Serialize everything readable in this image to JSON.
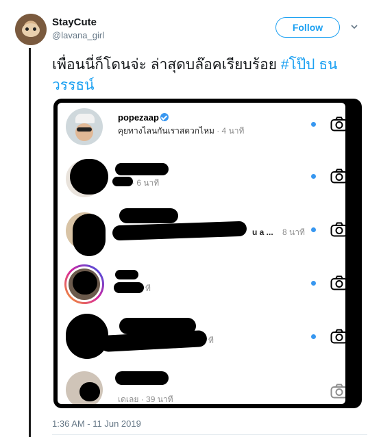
{
  "tweet": {
    "display_name": "StayCute",
    "handle": "@lavana_girl",
    "follow_label": "Follow",
    "text_main": "เพื่อนนี่ก็โดนจ่ะ ล่าสุดบล๊อคเรียบร้อย ",
    "hashtag": "#โป๊ป ธนวรรธน์",
    "timestamp": "1:36 AM - 11 Jun 2019"
  },
  "screenshot": {
    "rows": [
      {
        "username": "popezaap",
        "verified": true,
        "preview": "คุยทางไลนกันเราสดวกไหม",
        "time": " · 4 นาที",
        "unread": true
      },
      {
        "username": "",
        "preview": "",
        "time": "· 6 นาที",
        "unread": true
      },
      {
        "username": "",
        "preview": "u a ...",
        "time": "8 นาที",
        "unread": true
      },
      {
        "username": "",
        "preview": "",
        "time": "ที",
        "unread": true
      },
      {
        "username": "",
        "preview": "",
        "time": "ที",
        "unread": true
      },
      {
        "username": "",
        "preview": "เดเลย",
        "time": " · 39 นาที",
        "unread": false
      }
    ]
  },
  "icons": {
    "camera": "camera-icon",
    "chevron": "chevron-down-icon",
    "verified": "verified-badge-icon"
  },
  "colors": {
    "accent": "#1da1f2",
    "instagram_blue": "#3897f0"
  }
}
